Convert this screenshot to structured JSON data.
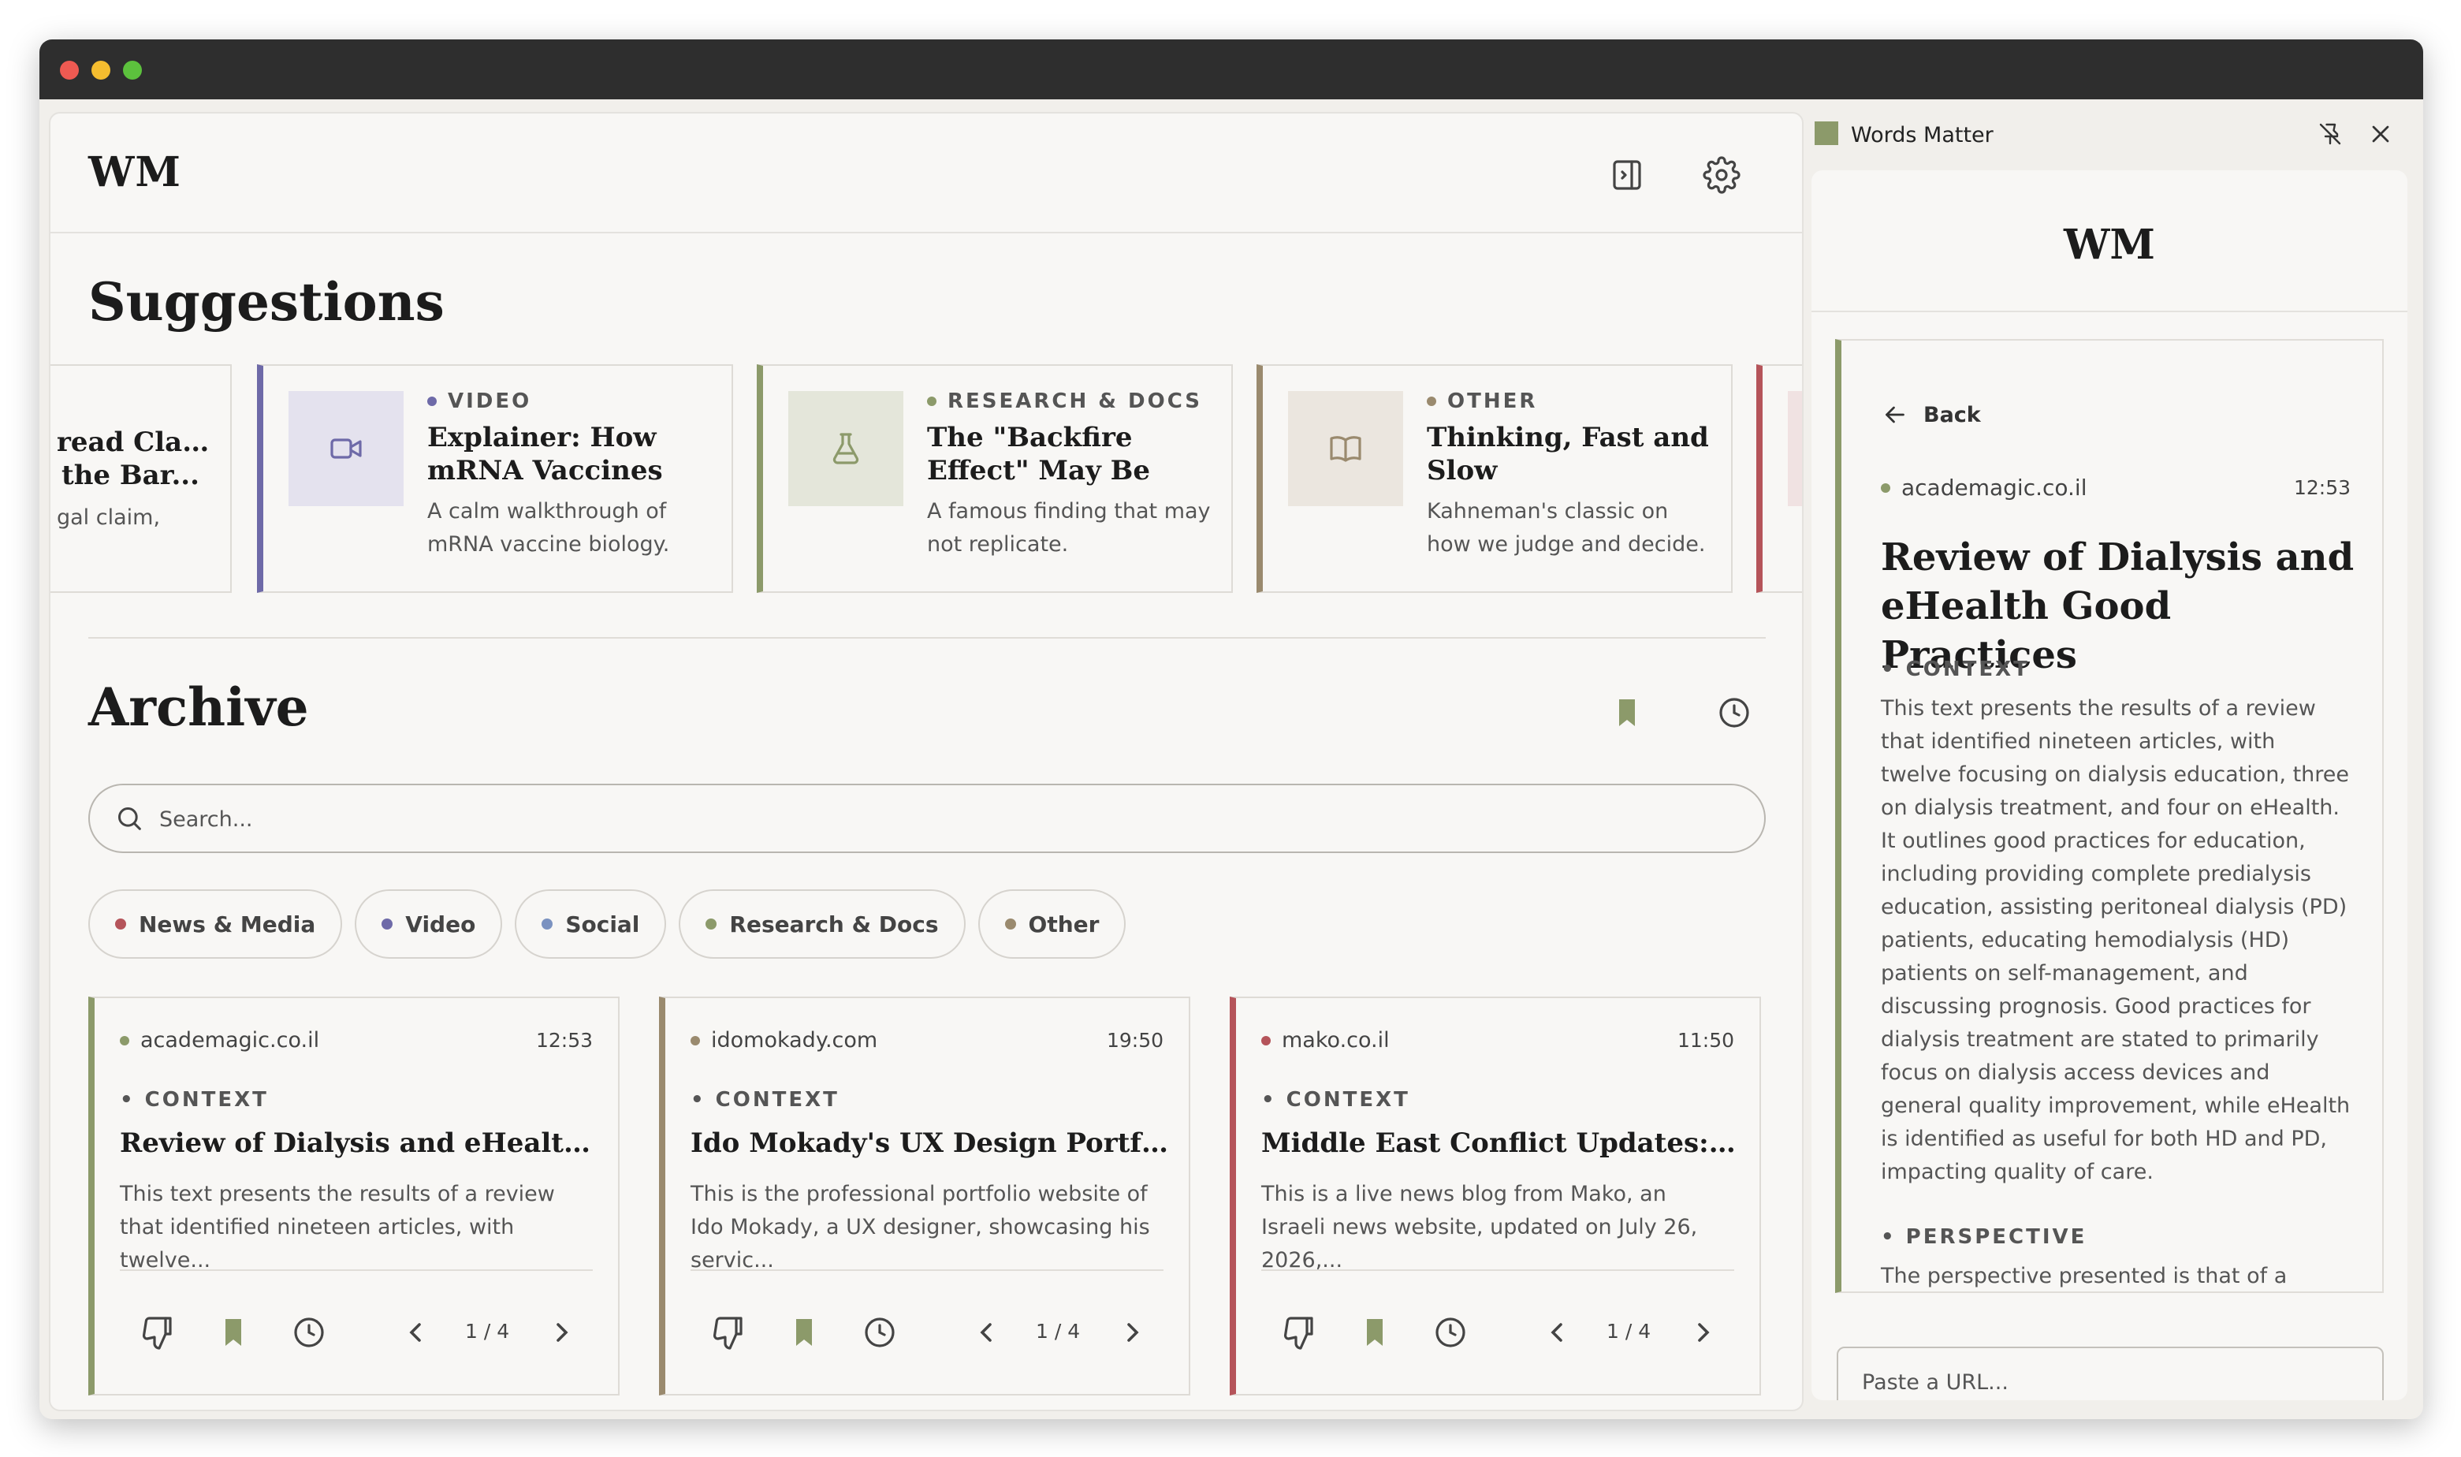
{
  "colors": {
    "news": "#b5545a",
    "video": "#6e6aa8",
    "research": "#8c9a6a",
    "other": "#9a8a6e",
    "accent": "#8c9a6a"
  },
  "header": {
    "logo": "WM"
  },
  "suggestions": {
    "title": "Suggestions",
    "partial_card": {
      "title_line1": "read Claims",
      "title_line2": "the Bar...",
      "desc": "gal claim,"
    },
    "cards": [
      {
        "category": "VIDEO",
        "title": "Explainer: How mRNA Vaccines Actually...",
        "desc": "A calm walkthrough of mRNA vaccine biology.",
        "icon": "video-icon"
      },
      {
        "category": "RESEARCH & DOCS",
        "title": "The \"Backfire Effect\" May Be Rarer Than...",
        "desc": "A famous finding that may not replicate.",
        "icon": "flask-icon"
      },
      {
        "category": "OTHER",
        "title": "Thinking, Fast and Slow",
        "desc": "Kahneman's classic on how we judge and decide.",
        "icon": "book-icon"
      }
    ]
  },
  "archive": {
    "title": "Archive",
    "search_placeholder": "Search...",
    "filters": [
      "News & Media",
      "Video",
      "Social",
      "Research & Docs",
      "Other"
    ],
    "cards": [
      {
        "source": "academagic.co.il",
        "time": "12:53",
        "label": "CONTEXT",
        "title": "Review of Dialysis and eHealth Good Practices",
        "desc": "This text presents the results of a review that identified nineteen articles, with twelve...",
        "page": "1 / 4"
      },
      {
        "source": "idomokady.com",
        "time": "19:50",
        "label": "CONTEXT",
        "title": "Ido Mokady's UX Design Portfolio",
        "desc": "This is the professional portfolio website of Ido Mokady, a UX designer, showcasing his servic...",
        "page": "1 / 4"
      },
      {
        "source": "mako.co.il",
        "time": "11:50",
        "label": "CONTEXT",
        "title": "Middle East Conflict Updates: US, Iran and Israel",
        "desc": "This is a live news blog from Mako, an Israeli news website, updated on July 26, 2026,...",
        "page": "1 / 4"
      }
    ]
  },
  "panel": {
    "app_name": "Words Matter",
    "logo": "WM",
    "back_label": "Back",
    "source": "academagic.co.il",
    "time": "12:53",
    "title": "Review of Dialysis and eHealth Good Practices",
    "context_label": "CONTEXT",
    "context_text": "This text presents the results of a review that identified nineteen articles, with twelve focusing on dialysis education, three on dialysis treatment, and four on eHealth. It outlines good practices for education, including providing complete predialysis education, assisting peritoneal dialysis (PD) patients, educating hemodialysis (HD) patients on self-management, and discussing prognosis. Good practices for dialysis treatment are stated to primarily focus on dialysis access devices and general quality improvement, while eHealth is identified as useful for both HD and PD, impacting quality of care.",
    "perspective_label": "PERSPECTIVE",
    "perspective_text": "The perspective presented is that of a",
    "url_placeholder": "Paste a URL..."
  }
}
